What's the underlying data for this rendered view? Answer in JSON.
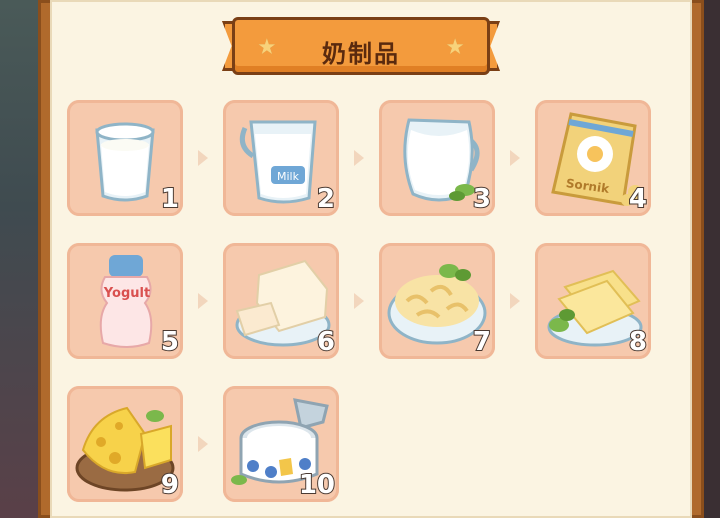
{
  "header": {
    "title": "奶制品"
  },
  "items": [
    {
      "number": "1",
      "name": "milk-glass"
    },
    {
      "number": "2",
      "name": "milk-jug"
    },
    {
      "number": "3",
      "name": "milk-pitcher"
    },
    {
      "number": "4",
      "name": "milk-powder-bag",
      "label": "Sornik"
    },
    {
      "number": "5",
      "name": "yogurt-bottle",
      "label": "Yogult"
    },
    {
      "number": "6",
      "name": "tofu-cheese-block"
    },
    {
      "number": "7",
      "name": "macaroni-bowl"
    },
    {
      "number": "8",
      "name": "cheese-slices"
    },
    {
      "number": "9",
      "name": "swiss-cheese-board"
    },
    {
      "number": "10",
      "name": "canned-cream"
    }
  ],
  "jug_label": "Milk",
  "colors": {
    "card": "#f6c9ad",
    "panel": "#fbf4e2",
    "banner": "#f39b3d",
    "frame": "#b06a2c"
  }
}
